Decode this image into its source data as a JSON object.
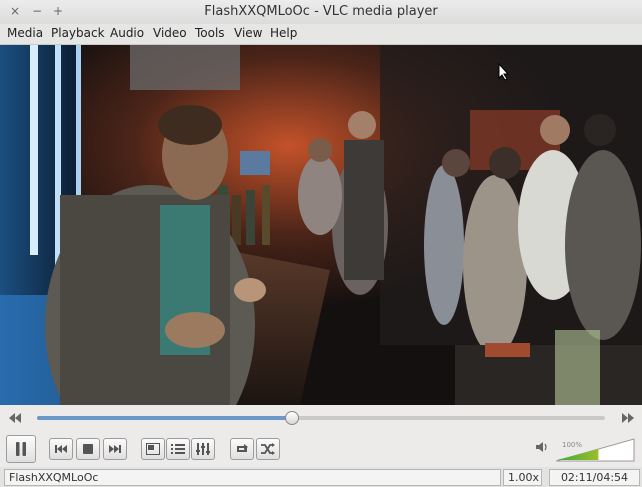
{
  "window": {
    "title": "FlashXXQMLoOc - VLC media player",
    "buttons": [
      "×",
      "−",
      "+"
    ]
  },
  "menubar": {
    "items": [
      "Media",
      "Playback",
      "Audio",
      "Video",
      "Tools",
      "View",
      "Help"
    ]
  },
  "playback": {
    "position_fraction": 0.447,
    "state": "playing"
  },
  "volume": {
    "label": "100%",
    "level_fraction": 0.53
  },
  "status": {
    "filename": "FlashXXQMLoOc",
    "speed": "1.00x",
    "time": "02:11/04:54"
  },
  "icons": {
    "seek_back": "fast-backward-icon",
    "seek_forward": "fast-forward-icon",
    "pause": "pause-icon",
    "previous": "skip-previous-icon",
    "stop": "stop-icon",
    "next": "skip-next-icon",
    "fullscreen": "fullscreen-icon",
    "playlist": "playlist-icon",
    "extended": "equalizer-icon",
    "loop": "loop-icon",
    "shuffle": "shuffle-icon",
    "speaker": "speaker-icon"
  },
  "colors": {
    "accent": "#6a98c8",
    "volume_low": "#3fa83a",
    "volume_high": "#e8d21c"
  }
}
